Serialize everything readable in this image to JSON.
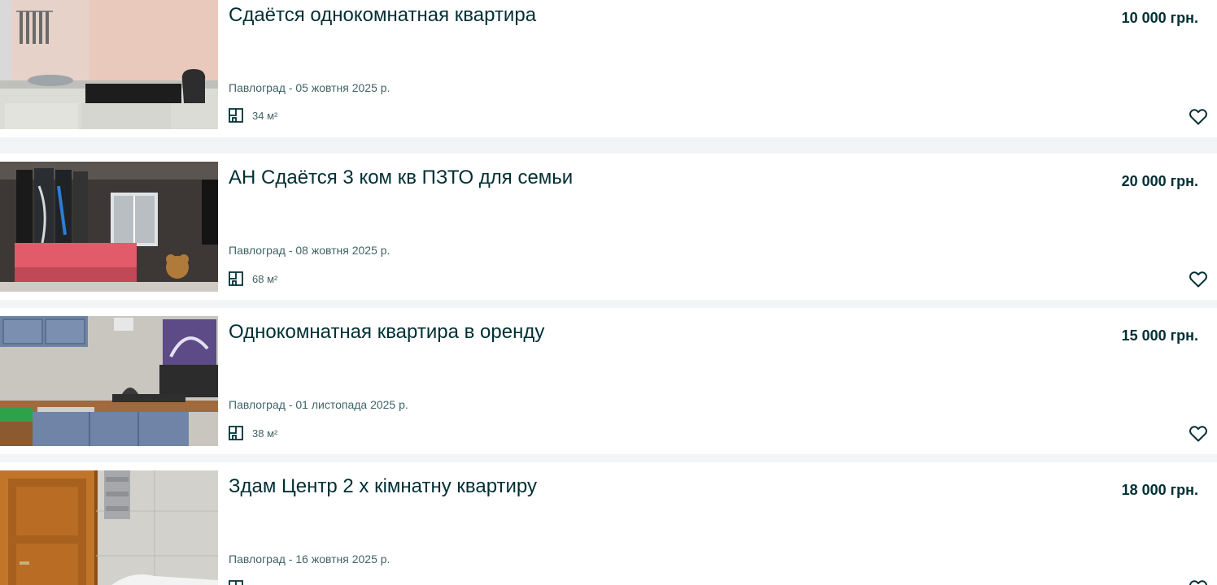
{
  "listings": [
    {
      "title": "Сдаётся однокомнатная квартира",
      "price": "10 000 грн.",
      "location": "Павлоград - 05 жовтня 2025 р.",
      "area": "34 м²",
      "photo_icon": "kitchen-photo",
      "favorite_icon": "heart-outline-icon"
    },
    {
      "title": "АН Сдаётся 3 ком кв ПЗТО для семьи",
      "price": "20 000 грн.",
      "location": "Павлоград - 08 жовтня 2025 р.",
      "area": "68 м²",
      "photo_icon": "living-room-photo",
      "favorite_icon": "heart-outline-icon"
    },
    {
      "title": "Однокомнатная квартира в оренду",
      "price": "15 000 грн.",
      "location": "Павлоград - 01 листопада 2025 р.",
      "area": "38 м²",
      "photo_icon": "kitchen-photo",
      "favorite_icon": "heart-outline-icon"
    },
    {
      "title": "Здам Центр 2 х кімнатну квартиру",
      "price": "18 000 грн.",
      "location": "Павлоград - 16 жовтня 2025 р.",
      "area": "",
      "photo_icon": "bathroom-photo",
      "favorite_icon": "heart-outline-icon"
    }
  ],
  "colors": {
    "text_primary": "#002f34",
    "text_secondary": "#406367",
    "background": "#f2f4f5",
    "card": "#ffffff"
  }
}
